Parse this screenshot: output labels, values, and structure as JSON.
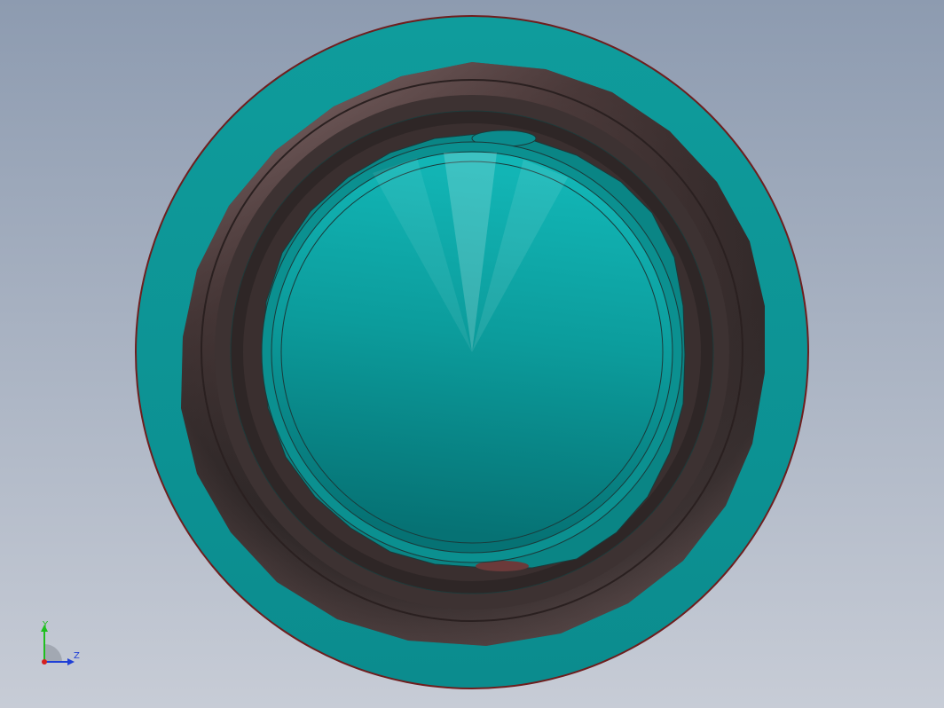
{
  "viewport": {
    "background_top": "#8d9bb0",
    "background_bottom": "#c7ccd6"
  },
  "model": {
    "outer_ring_color": "#0c9696",
    "outer_edge_color": "#7a1f1f",
    "groove_color": "#3b2f2f",
    "groove_highlight": "#b49a9a",
    "inner_face_color": "#0d9a9a",
    "inner_face_dark": "#06767a",
    "edge_line_color": "#1a3a3a"
  },
  "triad": {
    "y_label": "Y",
    "z_label": "Z",
    "y_color": "#1fbf1f",
    "z_color": "#1f3fd6",
    "x_color": "#d61f1f"
  }
}
